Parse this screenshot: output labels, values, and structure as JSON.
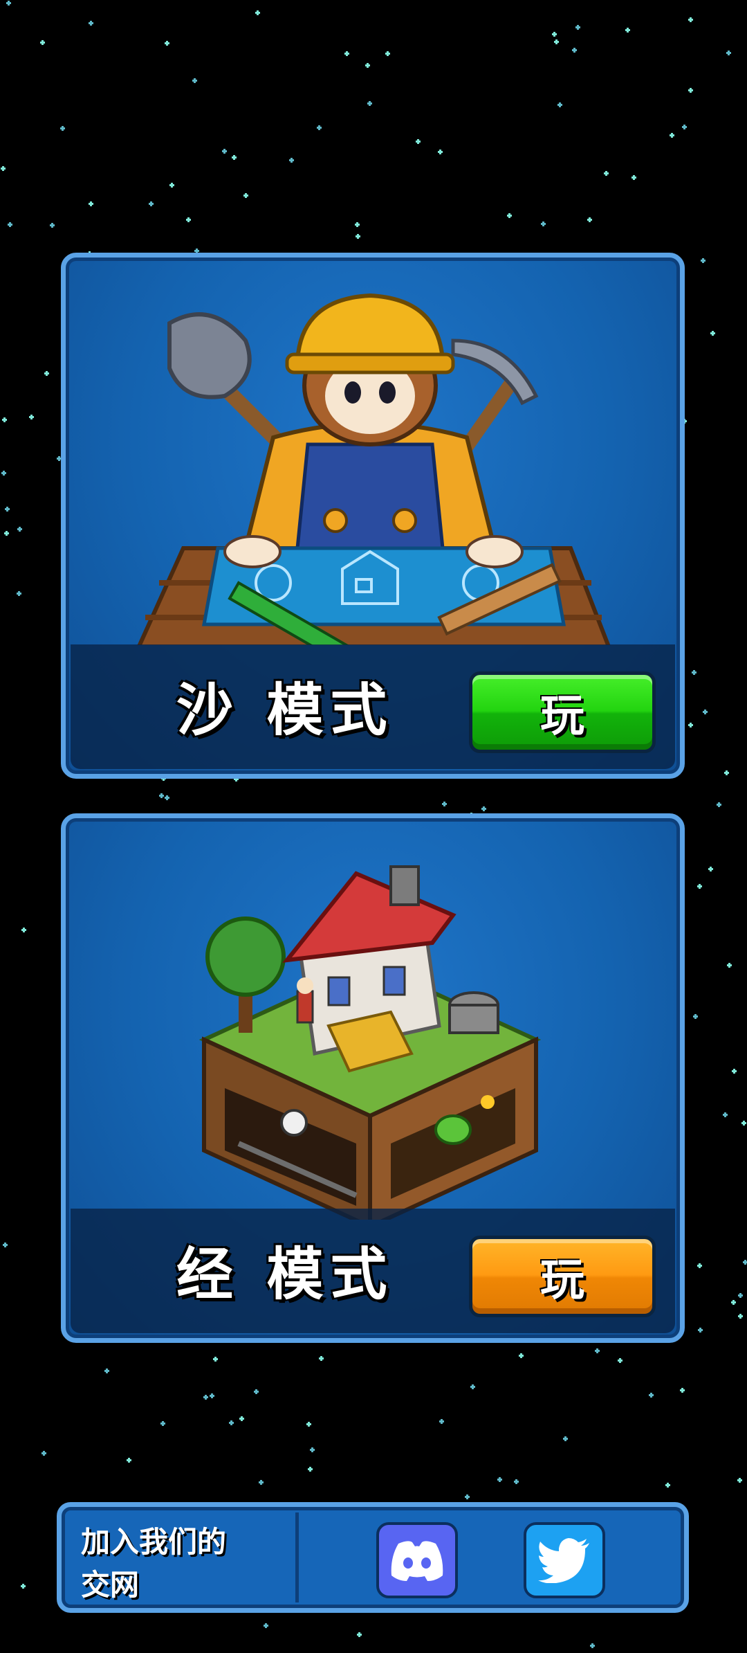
{
  "modes": {
    "sandbox": {
      "title": "沙 模式",
      "play_label": "玩",
      "accent": "#23d410"
    },
    "classic": {
      "title": "经 模式",
      "play_label": "玩",
      "accent": "#ff9a12"
    }
  },
  "social": {
    "label_line1": "加入我们的",
    "label_line2": "交网",
    "icons": [
      "discord-icon",
      "twitter-icon"
    ]
  },
  "colors": {
    "background": "#000000",
    "card": "#1463b0",
    "card_border": "#5aa2e6"
  }
}
